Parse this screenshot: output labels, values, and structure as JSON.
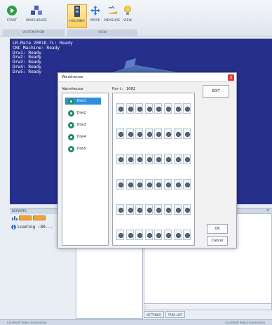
{
  "ribbon": {
    "buttons": [
      {
        "label": "START",
        "icon": "play-icon"
      },
      {
        "label": "WAREHOUSE",
        "icon": "warehouse-icon"
      },
      {
        "label": "HOUSING",
        "icon": "housing-icon",
        "active": true
      },
      {
        "label": "MOVE",
        "icon": "move-icon"
      },
      {
        "label": "MEASURE",
        "icon": "measure-icon"
      },
      {
        "label": "VIEW",
        "icon": "lightbulb-icon"
      }
    ],
    "groups": [
      "AUTOMATION",
      "VIEW"
    ]
  },
  "status_log": [
    "LR-Mate 200iD-7L: Ready",
    "CNC Machine: Ready",
    "Drw1: Ready",
    "Drw2: Ready",
    "Drw3: Ready",
    "Drw4: Ready",
    "Drw5: Ready"
  ],
  "reports": {
    "title": "REPORTS",
    "log_entry": "Loading :80..."
  },
  "bottom_tabs": [
    "SETTINGS",
    "TASK LIST"
  ],
  "statusbar": {
    "left": "CandiSoft Robot Automation",
    "right": "CandiSoft Robot Automation"
  },
  "warehouse_dialog": {
    "title": "Warehouse",
    "close_symbol": "x",
    "list_header": "Warehouse",
    "part_label": "Part: 1002",
    "drawers": [
      "Drw1",
      "Drw2",
      "Drw3",
      "Drw4",
      "Drw5"
    ],
    "selected_drawer": "Drw1",
    "grid_rows": 6,
    "grid_cols": 8,
    "edit_label": "EDIT",
    "ok_label": "OK",
    "cancel_label": "Cancel"
  },
  "colors": {
    "viewport_bg": "#272f8c",
    "selection": "#2f8fdc",
    "drawer_icon": "#1e8f60",
    "ribbon_active": "#ffcf5e"
  }
}
